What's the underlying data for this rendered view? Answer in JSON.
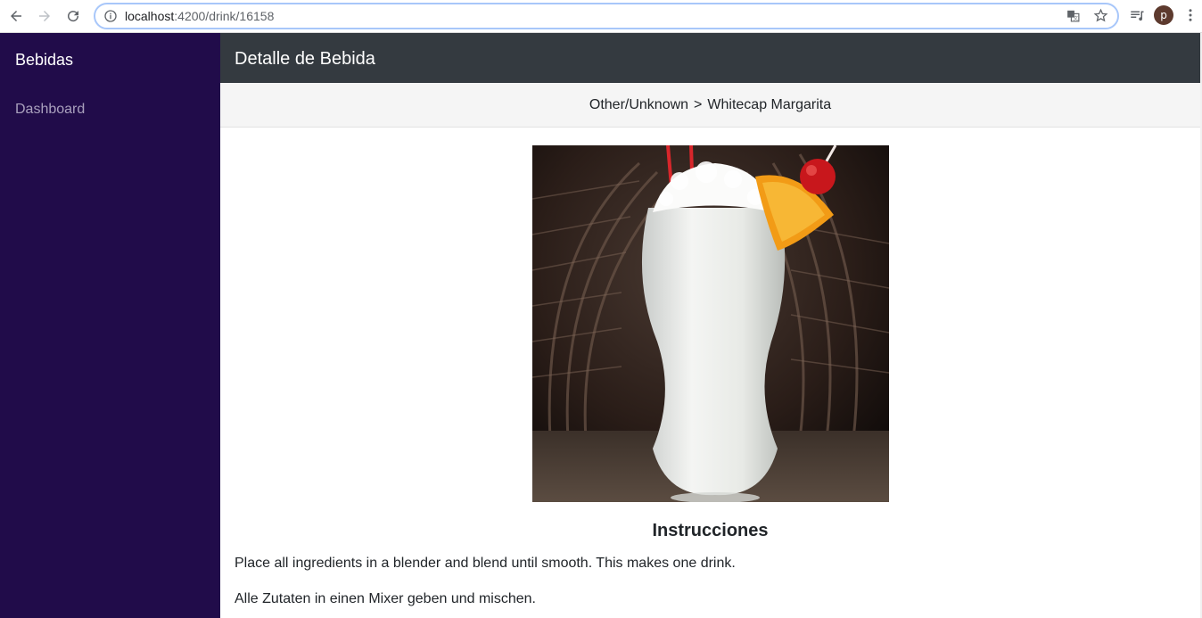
{
  "browser": {
    "url_host": "localhost",
    "url_rest": ":4200/drink/16158",
    "profile_initial": "p"
  },
  "sidebar": {
    "brand": "Bebidas",
    "items": [
      {
        "label": "Dashboard"
      }
    ]
  },
  "header": {
    "title": "Detalle de Bebida"
  },
  "breadcrumb": {
    "category": "Other/Unknown",
    "separator": ">",
    "drink": "Whitecap Margarita"
  },
  "drink": {
    "image_subject": "white frozen cocktail in hurricane glass with coconut, orange slice and cherry"
  },
  "instructions": {
    "heading": "Instrucciones",
    "en": "Place all ingredients in a blender and blend until smooth. This makes one drink.",
    "de": "Alle Zutaten in einen Mixer geben und mischen."
  },
  "colors": {
    "sidebar_bg": "#210c4a",
    "topbar_bg": "#343a40",
    "breadcrumb_bg": "#f5f5f5"
  }
}
